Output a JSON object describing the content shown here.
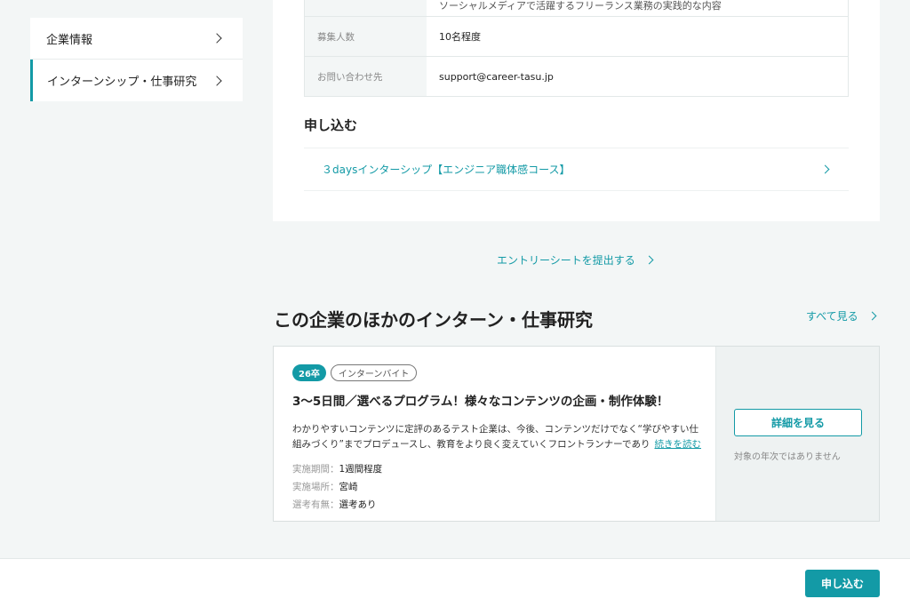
{
  "sidebar": {
    "items": [
      {
        "label": "企業情報"
      },
      {
        "label": "インターンシップ・仕事研究"
      }
    ]
  },
  "info_table": {
    "cut_row_text": "ソーシャルメディアで活躍するフリーランス業務の実践的な内容",
    "rows": [
      {
        "label": "募集人数",
        "value": "10名程度"
      },
      {
        "label": "お問い合わせ先",
        "value": "support@career-tasu.jp"
      }
    ]
  },
  "apply": {
    "heading": "申し込む",
    "course": "３daysインターシップ【エンジニア職体感コース】"
  },
  "entry_sheet_link": "エントリーシートを提出する",
  "other_section": {
    "title": "この企業のほかのインターン・仕事研究",
    "see_all": "すべて見る"
  },
  "intern_card": {
    "badge_year": "26卒",
    "badge_type": "インターンバイト",
    "title": "3〜5日間／選べるプログラム！様々なコンテンツの企画・制作体験！",
    "description": "わかりやすいコンテンツに定評のあるテスト企業は、今後、コンテンツだけでなく“学びやすい仕組みづくり”までプロデュースし、教育をより良く変えていくフロントランナーであり",
    "read_more": "続きを読む",
    "meta": [
      {
        "key": "実施期間：",
        "value": "1週間程度"
      },
      {
        "key": "実施場所：",
        "value": "宮崎"
      },
      {
        "key": "選考有無：",
        "value": "選考あり"
      }
    ],
    "detail_button": "詳細を見る",
    "not_target": "対象の年次ではありません"
  },
  "footer": {
    "apply_button": "申し込む"
  },
  "colors": {
    "accent": "#139aa6",
    "background": "#f3f6f6"
  }
}
